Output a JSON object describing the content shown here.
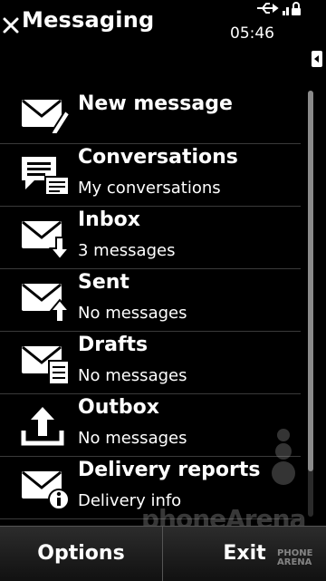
{
  "header": {
    "title": "Messaging",
    "clock": "05:46"
  },
  "items": [
    {
      "label": "New message",
      "sub": "",
      "icon": "new-message-icon"
    },
    {
      "label": "Conversations",
      "sub": "My conversations",
      "icon": "conversations-icon"
    },
    {
      "label": "Inbox",
      "sub": "3 messages",
      "icon": "inbox-icon"
    },
    {
      "label": "Sent",
      "sub": "No messages",
      "icon": "sent-icon"
    },
    {
      "label": "Drafts",
      "sub": "No messages",
      "icon": "drafts-icon"
    },
    {
      "label": "Outbox",
      "sub": "No messages",
      "icon": "outbox-icon"
    },
    {
      "label": "Delivery reports",
      "sub": "Delivery info",
      "icon": "delivery-reports-icon"
    }
  ],
  "softkeys": {
    "left": "Options",
    "right": "Exit"
  },
  "watermark": {
    "text": "phoneArena",
    "small": "PHONE ARENA"
  }
}
